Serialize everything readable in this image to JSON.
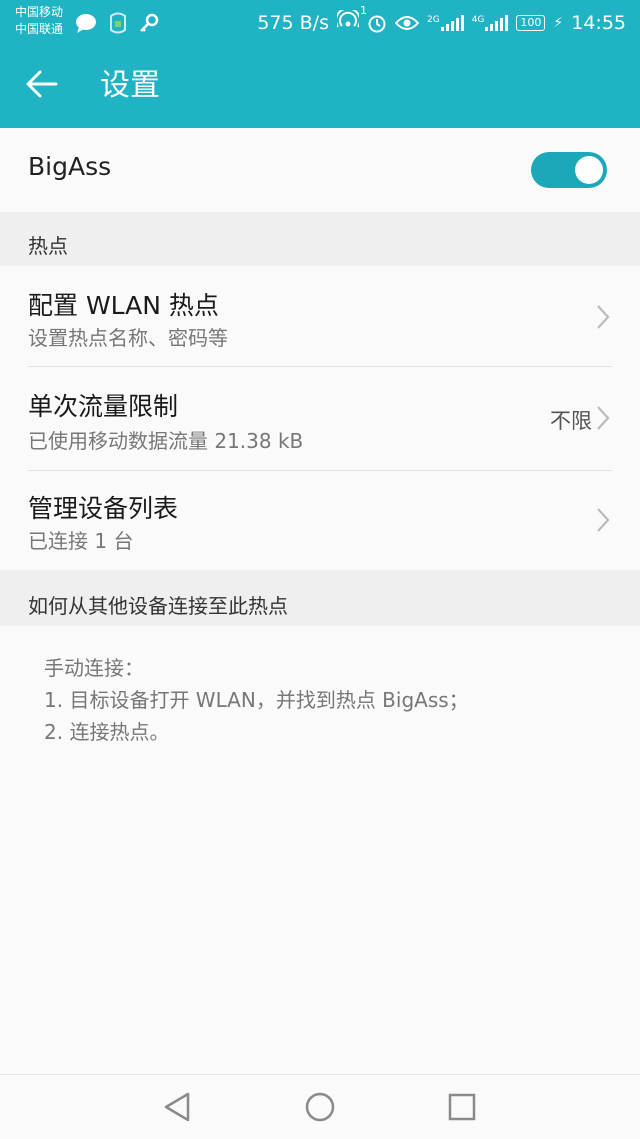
{
  "status_bar": {
    "carrier_1": "中国移动",
    "carrier_2": "中国联通",
    "speed": "575 B/s",
    "hotspot_badge": "1",
    "net_2g": "2G",
    "net_4g": "4G",
    "battery": "100",
    "time": "14:55"
  },
  "app_bar": {
    "title": "设置"
  },
  "hotspot_toggle": {
    "label": "BigAss",
    "on": true
  },
  "section_hotspot": {
    "header": "热点"
  },
  "items": [
    {
      "title": "配置 WLAN 热点",
      "subtitle": "设置热点名称、密码等",
      "value": ""
    },
    {
      "title": "单次流量限制",
      "subtitle": "已使用移动数据流量 21.38 kB",
      "value": "不限"
    },
    {
      "title": "管理设备列表",
      "subtitle": "已连接 1 台",
      "value": ""
    }
  ],
  "section_howto": {
    "header": "如何从其他设备连接至此热点"
  },
  "help": {
    "line1": "手动连接：",
    "line2": "1. 目标设备打开 WLAN，并找到热点 BigAss；",
    "line3": "2. 连接热点。"
  },
  "colors": {
    "accent": "#1fb3c4",
    "toggle": "#1ba9ba",
    "background": "#fafafa",
    "section": "#efefef"
  },
  "icons": [
    "back-arrow-icon",
    "chevron-right-icon",
    "nav-back-icon",
    "nav-home-icon",
    "nav-recents-icon"
  ]
}
